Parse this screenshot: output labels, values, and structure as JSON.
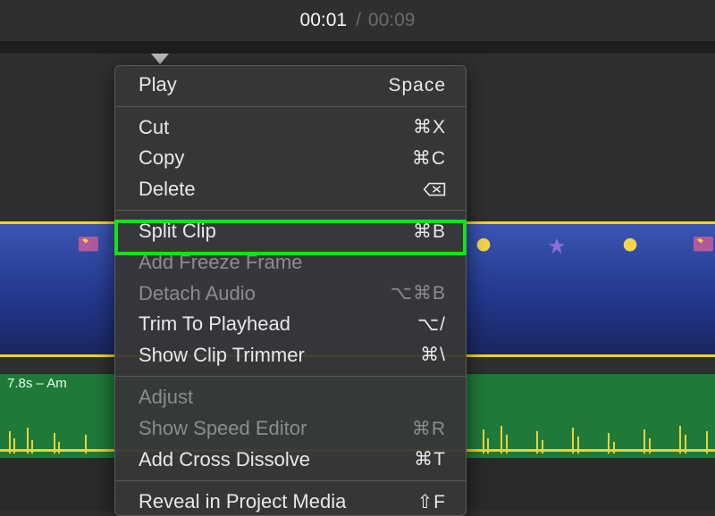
{
  "time": {
    "current": "00:01",
    "separator": "/",
    "total": "00:09"
  },
  "audio": {
    "clip_label": "7.8s – Am"
  },
  "menu": {
    "play": {
      "label": "Play",
      "shortcut": "Space",
      "enabled": true
    },
    "cut": {
      "label": "Cut",
      "shortcut": "⌘X",
      "enabled": true
    },
    "copy": {
      "label": "Copy",
      "shortcut": "⌘C",
      "enabled": true
    },
    "delete": {
      "label": "Delete",
      "shortcut": "⌫",
      "enabled": true
    },
    "split": {
      "label": "Split Clip",
      "shortcut": "⌘B",
      "enabled": true
    },
    "freeze": {
      "label": "Add Freeze Frame",
      "shortcut": "",
      "enabled": false
    },
    "detach": {
      "label": "Detach Audio",
      "shortcut": "⌥⌘B",
      "enabled": false
    },
    "trim": {
      "label": "Trim To Playhead",
      "shortcut": "⌥/",
      "enabled": true
    },
    "trimmer": {
      "label": "Show Clip Trimmer",
      "shortcut": "⌘\\",
      "enabled": true
    },
    "adjust": {
      "label": "Adjust",
      "shortcut": "",
      "enabled": false
    },
    "speed": {
      "label": "Show Speed Editor",
      "shortcut": "⌘R",
      "enabled": false
    },
    "crossdissolve": {
      "label": "Add Cross Dissolve",
      "shortcut": "⌘T",
      "enabled": true
    },
    "reveal": {
      "label": "Reveal in Project Media",
      "shortcut": "⇧F",
      "enabled": true
    }
  }
}
